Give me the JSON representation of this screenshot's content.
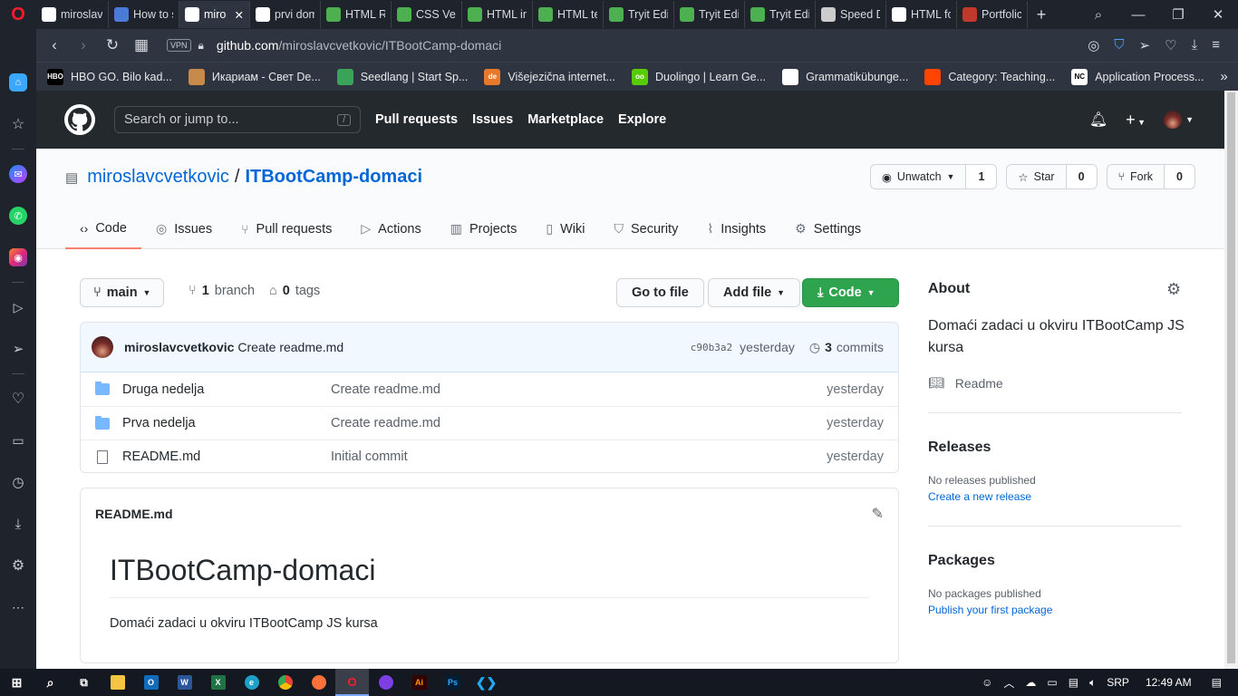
{
  "browser": {
    "tabs": [
      {
        "label": "miroslav",
        "icon": "github-icon",
        "color": "#ffffff"
      },
      {
        "label": "How to s",
        "icon": "app-icon",
        "color": "#4a7bd6"
      },
      {
        "label": "miro",
        "icon": "github-icon",
        "color": "#ffffff",
        "active": true
      },
      {
        "label": "prvi dom",
        "icon": "github-icon",
        "color": "#ffffff"
      },
      {
        "label": "HTML R",
        "icon": "w3-icon",
        "color": "#4caf50"
      },
      {
        "label": "CSS Vert",
        "icon": "w3-icon",
        "color": "#4caf50"
      },
      {
        "label": "HTML in",
        "icon": "w3-icon",
        "color": "#4caf50"
      },
      {
        "label": "HTML te",
        "icon": "w3-icon",
        "color": "#4caf50"
      },
      {
        "label": "Tryit Edit",
        "icon": "w3-icon",
        "color": "#4caf50"
      },
      {
        "label": "Tryit Edit",
        "icon": "w3-icon",
        "color": "#4caf50"
      },
      {
        "label": "Tryit Edit",
        "icon": "w3-icon",
        "color": "#4caf50"
      },
      {
        "label": "Speed D",
        "icon": "speed-dial-icon",
        "color": "#cccccc"
      },
      {
        "label": "HTML fo",
        "icon": "doc-icon",
        "color": "#ffffff"
      },
      {
        "label": "Portfolic",
        "icon": "portfolio-icon",
        "color": "#c0392b"
      }
    ],
    "new_tab": "+",
    "address": {
      "vpn": "VPN",
      "host": "github.com",
      "path": "/miroslavcvetkovic/ITBootCamp-domaci"
    },
    "bookmarks": [
      {
        "label": "HBO GO. Bilo kad...",
        "icon": "hbo-icon",
        "color": "#000000",
        "text": "HBO"
      },
      {
        "label": "Икариам - Свет De...",
        "icon": "ikariam-icon",
        "color": "#c78a4a",
        "text": ""
      },
      {
        "label": "Seedlang | Start Sp...",
        "icon": "seedlang-icon",
        "color": "#3aa35a",
        "text": ""
      },
      {
        "label": "Višejezična internet...",
        "icon": "de-icon",
        "color": "#e8782a",
        "text": "de"
      },
      {
        "label": "Duolingo | Learn Ge...",
        "icon": "duolingo-icon",
        "color": "#58cc02",
        "text": "oo"
      },
      {
        "label": "Grammatikübunge...",
        "icon": "page-icon",
        "color": "#ffffff",
        "text": ""
      },
      {
        "label": "Category: Teaching...",
        "icon": "reddit-icon",
        "color": "#ff4500",
        "text": ""
      },
      {
        "label": "Application Process...",
        "icon": "nc-icon",
        "color": "#ffffff",
        "text": "NC"
      }
    ]
  },
  "github": {
    "search_placeholder": "Search or jump to...",
    "search_key": "/",
    "nav": [
      "Pull requests",
      "Issues",
      "Marketplace",
      "Explore"
    ],
    "plus": "+"
  },
  "repo": {
    "owner": "miroslavcvetkovic",
    "separator": "/",
    "name": "ITBootCamp-domaci",
    "watch": {
      "label": "Unwatch",
      "count": "1"
    },
    "star": {
      "label": "Star",
      "count": "0"
    },
    "fork": {
      "label": "Fork",
      "count": "0"
    },
    "tabs": [
      "Code",
      "Issues",
      "Pull requests",
      "Actions",
      "Projects",
      "Wiki",
      "Security",
      "Insights",
      "Settings"
    ]
  },
  "toolbar": {
    "branch": "main",
    "branch_count": "1",
    "branch_word": "branch",
    "tag_count": "0",
    "tag_word": "tags",
    "go_to_file": "Go to file",
    "add_file": "Add file",
    "code": "Code"
  },
  "commit": {
    "author": "miroslavcvetkovic",
    "message": "Create readme.md",
    "sha": "c90b3a2",
    "time": "yesterday",
    "count": "3",
    "count_word": "commits"
  },
  "files": [
    {
      "type": "folder",
      "name": "Druga nedelja",
      "message": "Create readme.md",
      "date": "yesterday"
    },
    {
      "type": "folder",
      "name": "Prva nedelja",
      "message": "Create readme.md",
      "date": "yesterday"
    },
    {
      "type": "file",
      "name": "README.md",
      "message": "Initial commit",
      "date": "yesterday"
    }
  ],
  "readme": {
    "filename": "README.md",
    "heading": "ITBootCamp-domaci",
    "body": "Domaći zadaci u okviru ITBootCamp JS kursa"
  },
  "about": {
    "title": "About",
    "description": "Domaći zadaci u okviru ITBootCamp JS kursa",
    "readme_link": "Readme",
    "releases_title": "Releases",
    "releases_text": "No releases published",
    "releases_link": "Create a new release",
    "packages_title": "Packages",
    "packages_text": "No packages published",
    "packages_link": "Publish your first package"
  },
  "taskbar": {
    "lang": "SRP",
    "time": "12:49 AM"
  },
  "colors": {
    "link": "#0366d6",
    "green_button": "#2ea44f",
    "header_dark": "#24292e",
    "tab_underline": "#f9826c"
  }
}
